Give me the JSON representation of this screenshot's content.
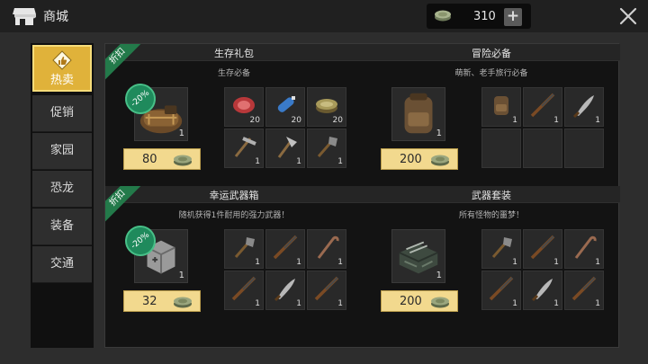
{
  "header": {
    "title": "商城",
    "coin_amount": "310",
    "plus_label": "+",
    "icons": [
      "shop-icon",
      "bottle-cap-icon",
      "plus-icon",
      "close-icon"
    ]
  },
  "sidebar": {
    "items": [
      "热卖",
      "促销",
      "家园",
      "恐龙",
      "装备",
      "交通"
    ],
    "active_index": 0
  },
  "colors": {
    "accent": "#e0b23a",
    "ribbon": "#237a4a",
    "price_bg": "#f2d98e"
  },
  "offers": [
    {
      "title": "生存礼包",
      "subtitle": "生存必备",
      "ribbon": "折扣",
      "discount": "-20%",
      "main_item": {
        "icon": "supply-bag-icon",
        "qty": "1"
      },
      "price": "80",
      "items": [
        {
          "icon": "meat-icon",
          "qty": "20"
        },
        {
          "icon": "water-bottle-icon",
          "qty": "20"
        },
        {
          "icon": "food-can-icon",
          "qty": "20"
        },
        {
          "icon": "pickaxe-icon",
          "qty": "1"
        },
        {
          "icon": "axe-icon",
          "qty": "1"
        },
        {
          "icon": "shovel-icon",
          "qty": "1"
        }
      ]
    },
    {
      "title": "冒险必备",
      "subtitle": "萌新、老手旅行必备",
      "ribbon": "",
      "discount": "",
      "main_item": {
        "icon": "backpack-icon",
        "qty": "1"
      },
      "price": "200",
      "items": [
        {
          "icon": "backpack-icon",
          "qty": "1"
        },
        {
          "icon": "rifle-icon",
          "qty": "1"
        },
        {
          "icon": "machete-icon",
          "qty": "1"
        }
      ]
    },
    {
      "title": "幸运武器箱",
      "subtitle": "随机获得1件耐用的强力武器！",
      "ribbon": "折扣",
      "discount": "-20%",
      "main_item": {
        "icon": "weapon-box-icon",
        "qty": "1"
      },
      "price": "32",
      "items": [
        {
          "icon": "shovel-icon",
          "qty": "1"
        },
        {
          "icon": "rifle-icon",
          "qty": "1"
        },
        {
          "icon": "crowbar-icon",
          "qty": "1"
        },
        {
          "icon": "rifle-icon",
          "qty": "1"
        },
        {
          "icon": "machete-icon",
          "qty": "1"
        },
        {
          "icon": "rifle-icon",
          "qty": "1"
        }
      ]
    },
    {
      "title": "武器套装",
      "subtitle": "所有怪物的噩梦！",
      "ribbon": "",
      "discount": "",
      "main_item": {
        "icon": "weapon-crate-icon",
        "qty": "1"
      },
      "price": "200",
      "items": [
        {
          "icon": "shovel-icon",
          "qty": "1"
        },
        {
          "icon": "rifle-icon",
          "qty": "1"
        },
        {
          "icon": "crowbar-icon",
          "qty": "1"
        },
        {
          "icon": "rifle-icon",
          "qty": "1"
        },
        {
          "icon": "machete-icon",
          "qty": "1"
        },
        {
          "icon": "rifle-icon",
          "qty": "1"
        }
      ]
    }
  ]
}
